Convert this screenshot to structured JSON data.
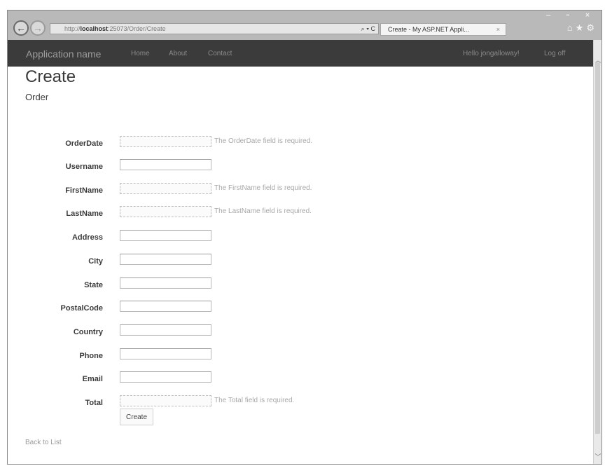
{
  "browser": {
    "url_prefix": "http://",
    "url_host": "localhost",
    "url_rest": ":25073/Order/Create",
    "address_icons": "⌕ ▾ C",
    "tab_title": "Create - My ASP.NET Appli...",
    "tab_close": "×",
    "min": "–",
    "max": "▫",
    "close": "×",
    "back_glyph": "←",
    "forward_glyph": "→",
    "toolbar_icons": "⌂★⚙"
  },
  "navbar": {
    "brand": "Application name",
    "links": [
      "Home",
      "About",
      "Contact"
    ],
    "user": "Hello jongalloway!",
    "logoff": "Log off"
  },
  "page": {
    "title": "Create",
    "subtitle": "Order"
  },
  "form": {
    "fields": [
      {
        "label": "OrderDate",
        "error": "The OrderDate field is required."
      },
      {
        "label": "Username",
        "error": ""
      },
      {
        "label": "FirstName",
        "error": "The FirstName field is required."
      },
      {
        "label": "LastName",
        "error": "The LastName field is required."
      },
      {
        "label": "Address",
        "error": ""
      },
      {
        "label": "City",
        "error": ""
      },
      {
        "label": "State",
        "error": ""
      },
      {
        "label": "PostalCode",
        "error": ""
      },
      {
        "label": "Country",
        "error": ""
      },
      {
        "label": "Phone",
        "error": ""
      },
      {
        "label": "Email",
        "error": ""
      },
      {
        "label": "Total",
        "error": "The Total field is required."
      }
    ],
    "submit": "Create"
  },
  "back_link": "Back to List",
  "colors": {
    "navbar": "#3b3b3b",
    "titlebar": "#b9b9b9"
  }
}
